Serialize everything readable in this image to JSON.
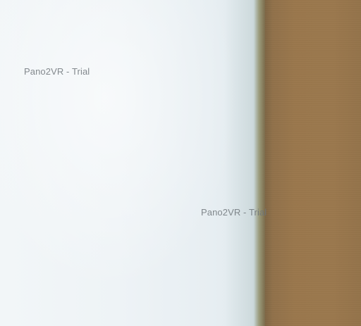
{
  "viewer": {
    "scene_colors": {
      "wall": "#eef3f5",
      "door": "#9a774c"
    },
    "watermarks": [
      {
        "text": "Pano2VR - Trial"
      },
      {
        "text": "Pano2VR - Trial"
      }
    ]
  }
}
